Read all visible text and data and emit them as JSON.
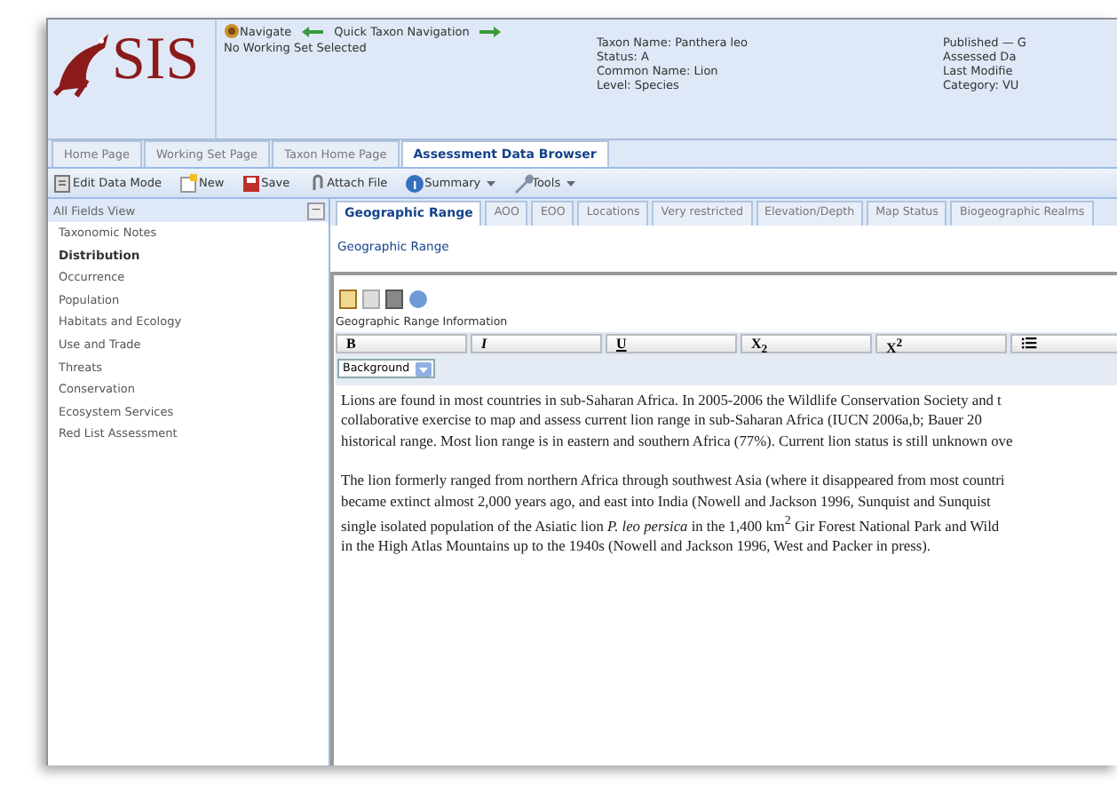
{
  "header": {
    "logo": "SIS",
    "navigate": "Navigate",
    "quick_nav": "Quick Taxon Navigation",
    "working_set": "No Working Set Selected",
    "taxon": [
      "Taxon Name: Panthera leo",
      "Status: A",
      "Common Name: Lion",
      "Level: Species"
    ],
    "assessment": [
      "Published — G",
      "Assessed Da",
      "Last Modifie",
      "Category: VU"
    ]
  },
  "tabs": [
    {
      "label": "Home Page",
      "selected": false
    },
    {
      "label": "Working Set Page",
      "selected": false
    },
    {
      "label": "Taxon Home Page",
      "selected": false
    },
    {
      "label": "Assessment Data Browser",
      "selected": true
    }
  ],
  "toolbar": [
    {
      "label": "Edit Data Mode",
      "kind": "button"
    },
    {
      "label": "New",
      "kind": "button"
    },
    {
      "label": "Save",
      "kind": "button"
    },
    {
      "label": "Attach File",
      "kind": "button"
    },
    {
      "label": "Summary",
      "kind": "menu"
    },
    {
      "label": "Tools",
      "kind": "menu"
    }
  ],
  "sidebar": {
    "title": "All Fields View",
    "collapse": "−",
    "items": [
      {
        "label": "Taxonomic Notes",
        "selected": false
      },
      {
        "label": "Distribution",
        "selected": true
      },
      {
        "label": "Occurrence",
        "selected": false
      },
      {
        "label": "Population",
        "selected": false
      },
      {
        "label": "Habitats and Ecology",
        "selected": false
      },
      {
        "label": "Use and Trade",
        "selected": false
      },
      {
        "label": "Threats",
        "selected": false
      },
      {
        "label": "Conservation",
        "selected": false
      },
      {
        "label": "Ecosystem Services",
        "selected": false
      },
      {
        "label": "Red List Assessment",
        "selected": false
      }
    ]
  },
  "field_tabs": [
    {
      "label": "Geographic Range",
      "selected": true
    },
    {
      "label": "AOO",
      "selected": false
    },
    {
      "label": "EOO",
      "selected": false
    },
    {
      "label": "Locations",
      "selected": false
    },
    {
      "label": "Very restricted",
      "selected": false
    },
    {
      "label": "Elevation/Depth",
      "selected": false
    },
    {
      "label": "Map Status",
      "selected": false
    },
    {
      "label": "Biogeographic Realms",
      "selected": false
    }
  ],
  "panel_title": "Geographic Range",
  "editor": {
    "label": "Geographic Range Information",
    "format_buttons": [
      "B",
      "I",
      "U",
      "X$_{2}$",
      "X$^{2}$",
      "⁝☰"
    ],
    "style_select": "Background",
    "paragraphs": [
      [
        "Lions are found in most countries in sub-Saharan Africa. In 2005-2006 the Wildlife Conservation Society and t",
        "collaborative exercise to map and assess current lion range in sub-Saharan Africa (IUCN 2006a,b; Bauer 20",
        "historical range. Most lion range is in eastern and southern Africa (77%). Current lion status is still unknown ove"
      ],
      [
        "The lion formerly ranged from northern Africa through southwest Asia (where it disappeared from most countri",
        "became extinct almost 2,000 years ago, and east into India (Nowell and Jackson 1996, Sunquist and Sunquist",
        "single isolated population of the Asiatic lion *P. leo persica* in the 1,400 km$^{2}$ Gir Forest National Park and Wild",
        "in the High Atlas Mountains up to the 1940s (Nowell and Jackson 1996, West and Packer in press)."
      ]
    ]
  }
}
